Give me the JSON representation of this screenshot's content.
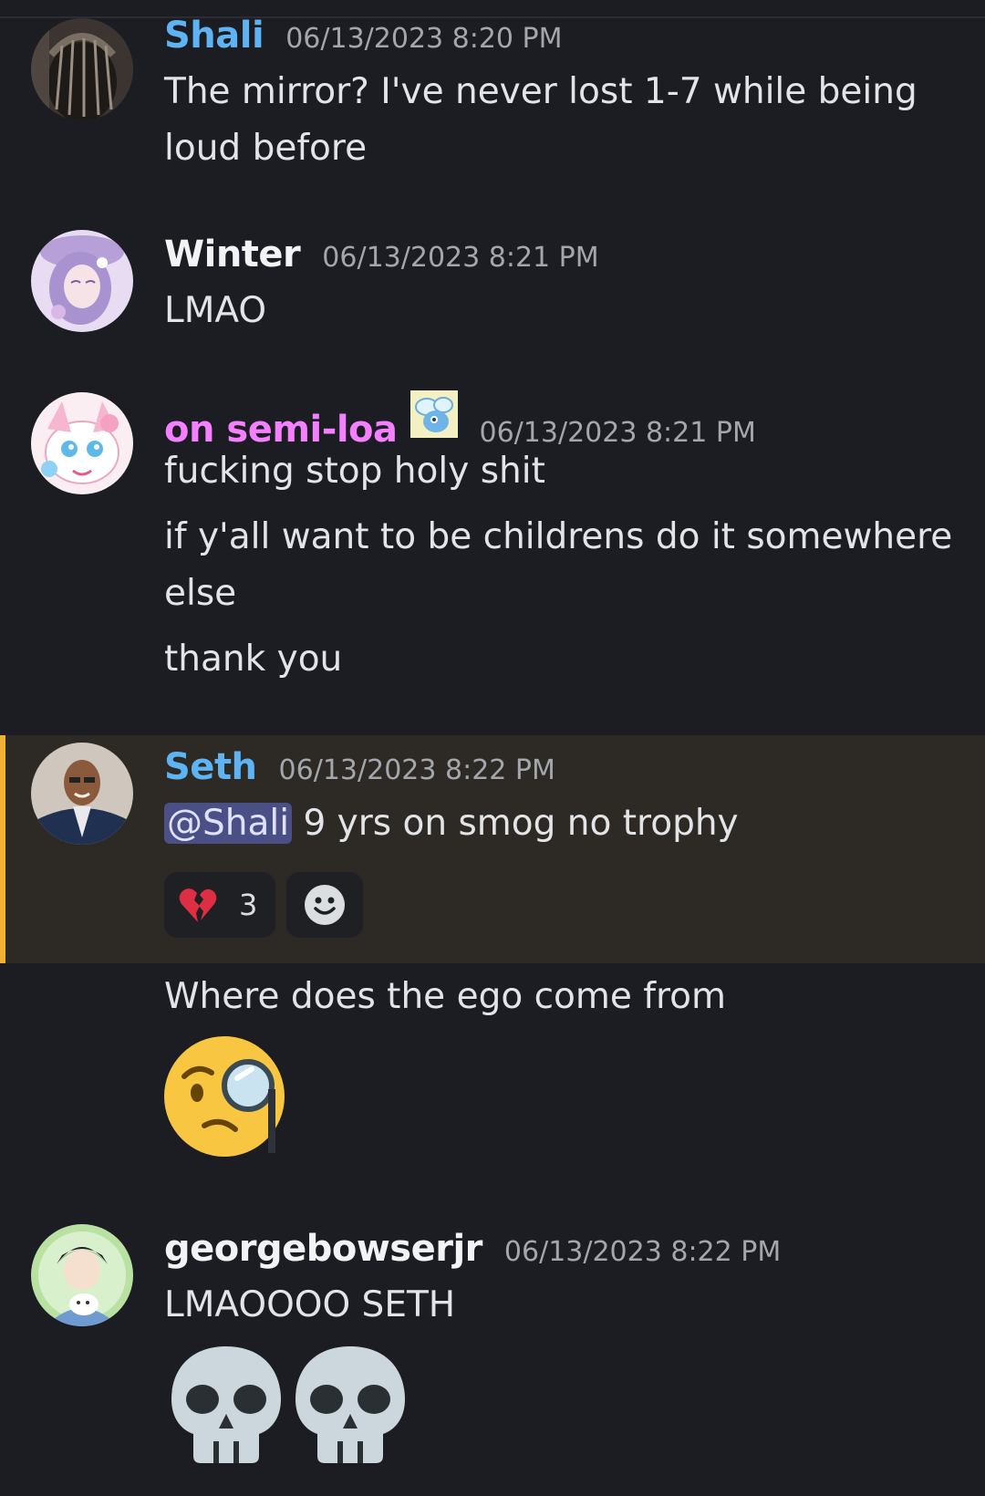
{
  "colors": {
    "background": "#1c1d22",
    "highlight_background": "#2d2a26",
    "highlight_bar": "#f0b232",
    "username_blue": "#5eb4f2",
    "username_white": "#f2f3f5",
    "username_pink": "#f47fff",
    "timestamp": "#a3a6ad",
    "mention_bg": "#4a4f86"
  },
  "messages": [
    {
      "author": "Shali",
      "timestamp": "06/13/2023 8:20 PM",
      "lines": [
        "The mirror? I've never lost 1-7 while being",
        "loud before"
      ]
    },
    {
      "author": "Winter",
      "timestamp": "06/13/2023 8:21 PM",
      "lines": [
        "LMAO"
      ]
    },
    {
      "author": "on semi-loa",
      "timestamp": "06/13/2023 8:21 PM",
      "badge_icon": "bug-pokemon-badge-icon",
      "lines": [
        "fucking stop holy shit",
        "if y'all want to be childrens do it somewhere",
        "else",
        "thank you"
      ]
    },
    {
      "author": "Seth",
      "timestamp": "06/13/2023 8:22 PM",
      "mention": "@Shali",
      "text": " 9 yrs on smog no trophy",
      "reactions": [
        {
          "icon": "broken-heart-icon",
          "count": "3"
        },
        {
          "icon": "add-reaction-icon",
          "count": ""
        }
      ],
      "followups": [
        "Where does the ego come from"
      ],
      "followup_emoji": "face-with-monocle-icon"
    },
    {
      "author": "georgebowserjr",
      "timestamp": "06/13/2023 8:22 PM",
      "lines": [
        "LMAOOOO SETH"
      ],
      "emoji": [
        "skull-icon",
        "skull-icon"
      ]
    }
  ]
}
